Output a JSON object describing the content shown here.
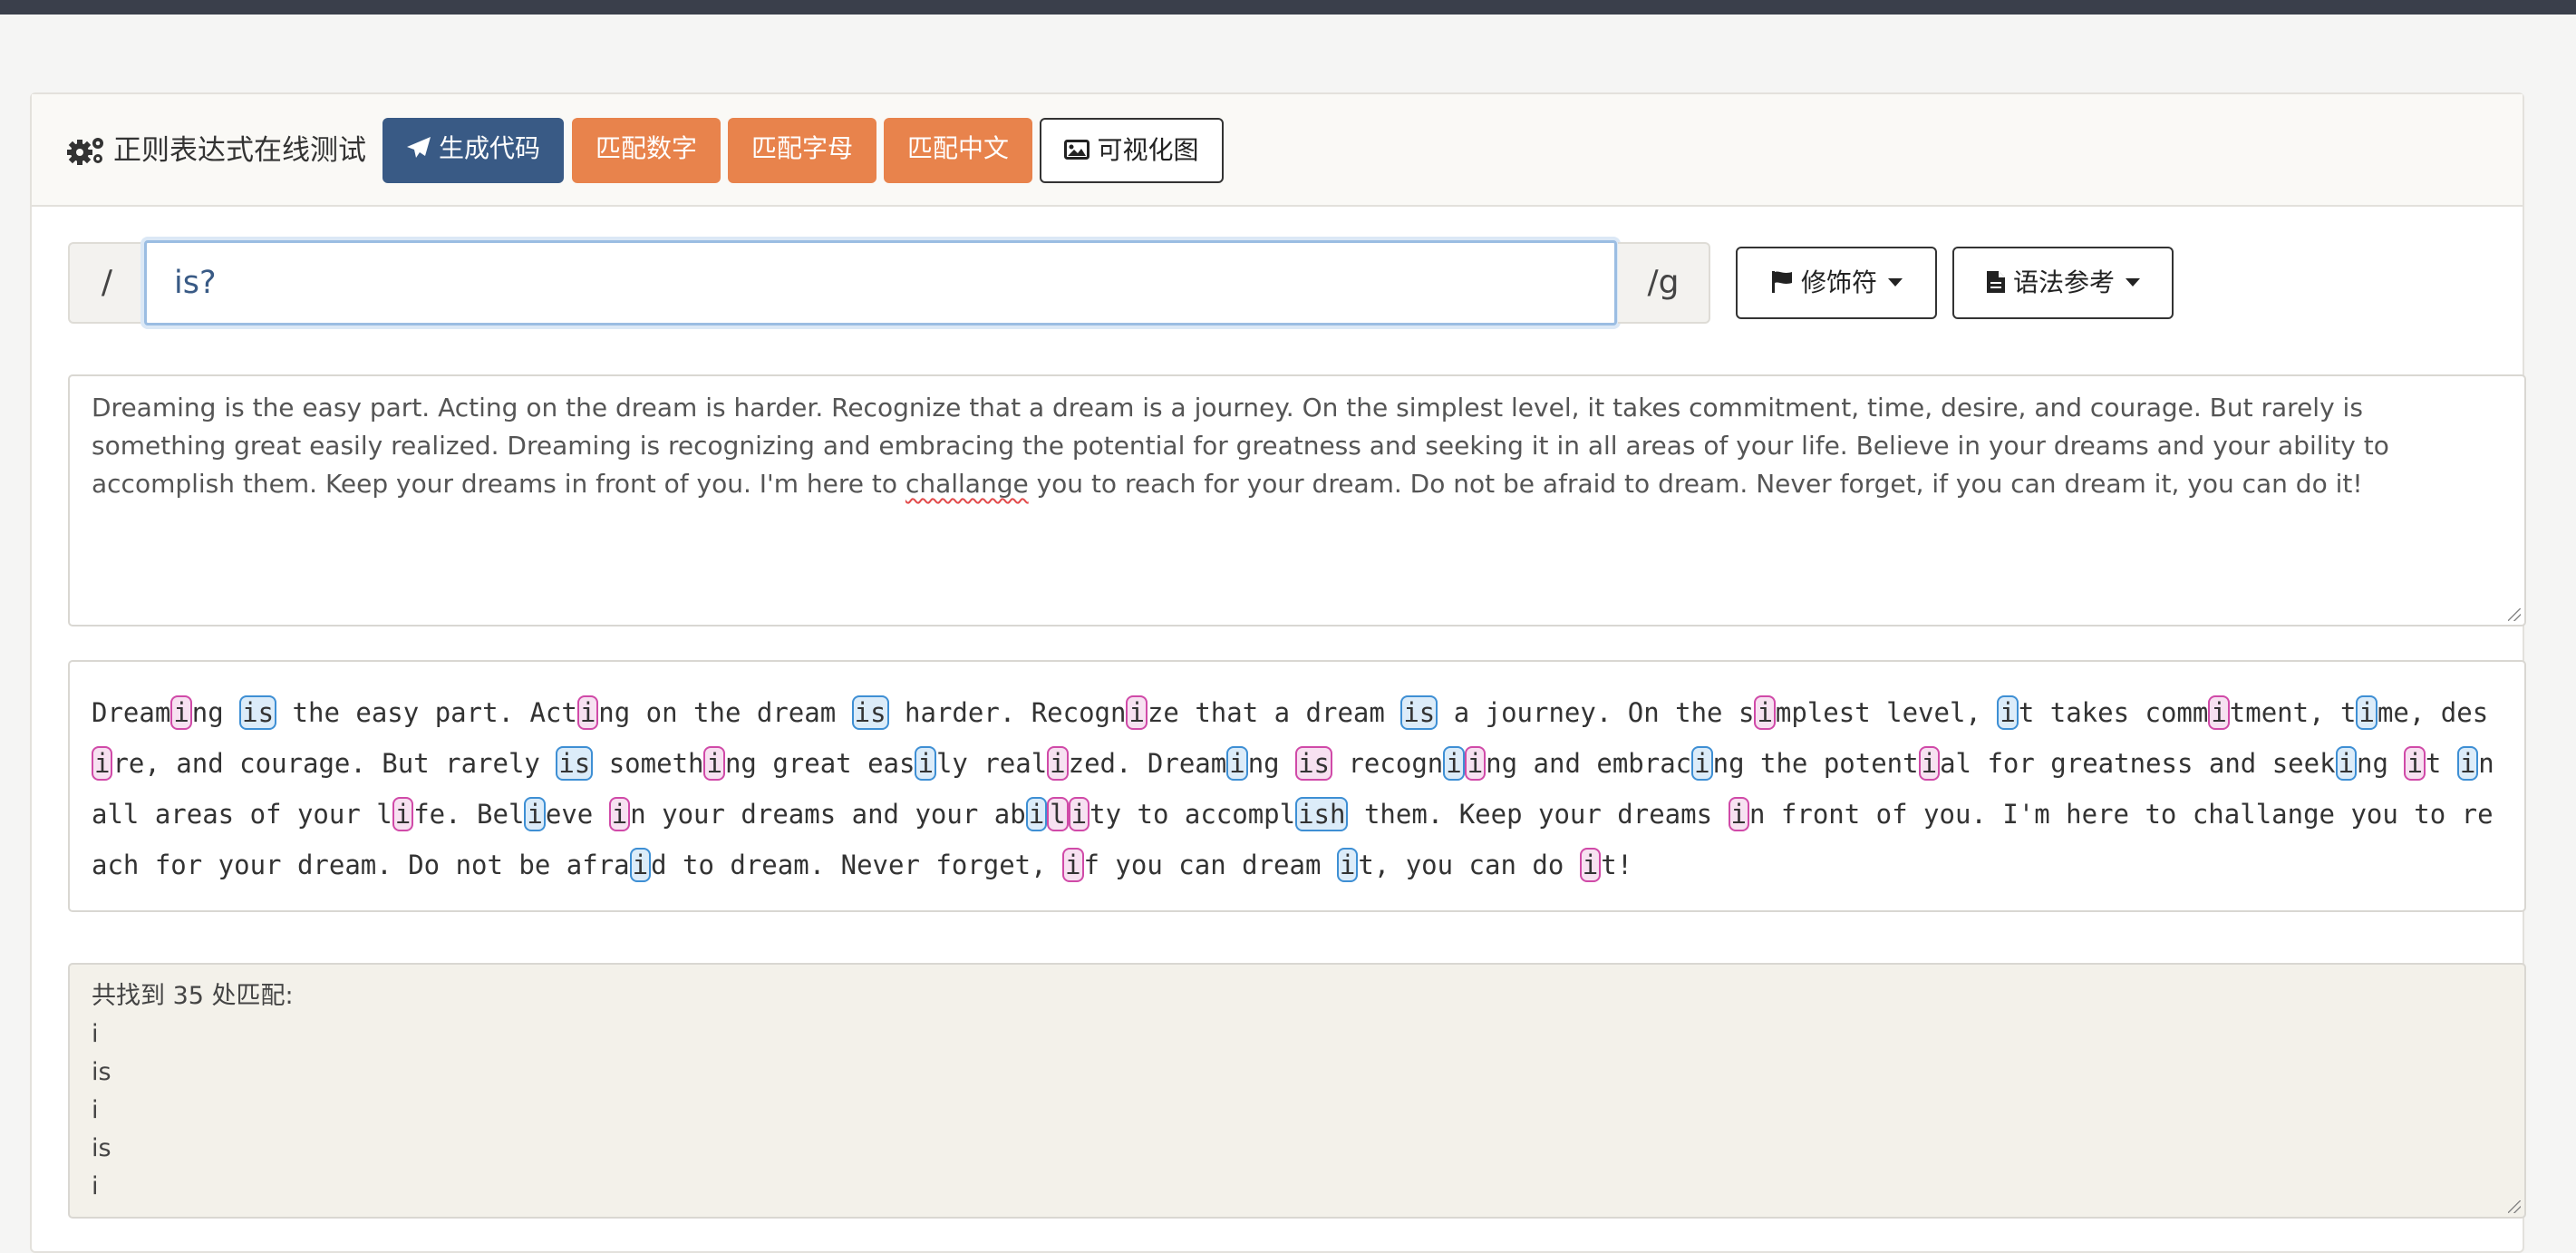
{
  "header": {
    "title": "正则表达式在线测试",
    "buttons": {
      "generate": "生成代码",
      "match_digits": "匹配数字",
      "match_letters": "匹配字母",
      "match_chinese": "匹配中文",
      "visualize": "可视化图"
    }
  },
  "regex": {
    "left_delimiter": "/",
    "pattern": "is?",
    "right_delimiter": "/g"
  },
  "dropdowns": {
    "modifiers": "修饰符",
    "syntax": "语法参考"
  },
  "test_text": {
    "before": "Dreaming is the easy part. Acting on the dream is harder. Recognize that a dream is a journey. On the simplest level, it takes commitment, time, desire, and courage. But rarely is something great easily realized. Dreaming is recognizing and embracing the potential for greatness and seeking it in all areas of your life. Believe in your dreams and your ability to accomplish them. Keep your dreams in front of you. I'm here to ",
    "misspelled": "challange",
    "after": " you to reach for your dream. Do not be afraid to dream. Never forget, if you can dream it, you can do it!"
  },
  "result_segments": [
    [
      "t",
      "Dream"
    ],
    [
      "p",
      "i"
    ],
    [
      "t",
      "ng "
    ],
    [
      "b",
      "is"
    ],
    [
      "t",
      " the easy part. Act"
    ],
    [
      "p",
      "i"
    ],
    [
      "t",
      "ng on the dream "
    ],
    [
      "b",
      "is"
    ],
    [
      "t",
      " harder. Recogn"
    ],
    [
      "p",
      "i"
    ],
    [
      "t",
      "ze that a dream "
    ],
    [
      "b",
      "is"
    ],
    [
      "t",
      " a journey. On the s"
    ],
    [
      "p",
      "i"
    ],
    [
      "t",
      "mplest level, "
    ],
    [
      "b",
      "i"
    ],
    [
      "t",
      "t takes comm"
    ],
    [
      "p",
      "i"
    ],
    [
      "t",
      "tment, t"
    ],
    [
      "b",
      "i"
    ],
    [
      "t",
      "me, des"
    ],
    [
      "p",
      "i"
    ],
    [
      "t",
      "re, and courage. But rarely "
    ],
    [
      "b",
      "is"
    ],
    [
      "t",
      " someth"
    ],
    [
      "p",
      "i"
    ],
    [
      "t",
      "ng great eas"
    ],
    [
      "b",
      "i"
    ],
    [
      "t",
      "ly real"
    ],
    [
      "p",
      "i"
    ],
    [
      "t",
      "zed. Dream"
    ],
    [
      "b",
      "i"
    ],
    [
      "t",
      "ng "
    ],
    [
      "p",
      "is"
    ],
    [
      "t",
      " recogn"
    ],
    [
      "b",
      "i"
    ],
    [
      "p",
      "i"
    ],
    [
      "t",
      "ng and embrac"
    ],
    [
      "b",
      "i"
    ],
    [
      "t",
      "ng the potent"
    ],
    [
      "p",
      "i"
    ],
    [
      "t",
      "al for greatness and seek"
    ],
    [
      "b",
      "i"
    ],
    [
      "t",
      "ng "
    ],
    [
      "p",
      "i"
    ],
    [
      "t",
      "t "
    ],
    [
      "b",
      "i"
    ],
    [
      "t",
      "n all areas of your l"
    ],
    [
      "p",
      "i"
    ],
    [
      "t",
      "fe. Bel"
    ],
    [
      "b",
      "i"
    ],
    [
      "t",
      "eve "
    ],
    [
      "p",
      "i"
    ],
    [
      "t",
      "n your dreams and your ab"
    ],
    [
      "b",
      "i"
    ],
    [
      "p",
      "l"
    ],
    [
      "p",
      "i"
    ],
    [
      "t",
      "ty to accompl"
    ],
    [
      "b",
      "ish"
    ],
    [
      "t",
      " them. Keep your dreams "
    ],
    [
      "p",
      "i"
    ],
    [
      "t",
      "n front of you. I'm here to challange you to reach for your dream. Do not be afra"
    ],
    [
      "b",
      "i"
    ],
    [
      "t",
      "d to dream. Never forget, "
    ],
    [
      "p",
      "i"
    ],
    [
      "t",
      "f you can dream "
    ],
    [
      "b",
      "i"
    ],
    [
      "t",
      "t, you can do "
    ],
    [
      "p",
      "i"
    ],
    [
      "t",
      "t!"
    ]
  ],
  "matches": {
    "summary": "共找到 35 处匹配:",
    "items": [
      "i",
      "is",
      "i",
      "is",
      "i"
    ]
  },
  "colors": {
    "primary": "#395a85",
    "orange": "#e8834c",
    "match_pink": "#d04aa8",
    "match_blue": "#3e8fd4"
  }
}
